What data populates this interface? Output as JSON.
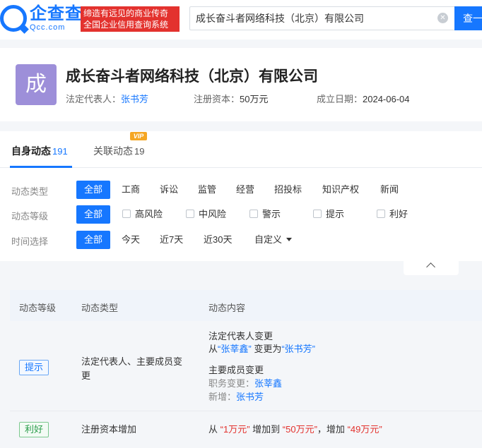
{
  "header": {
    "logo_cn": "企查查",
    "logo_en": "Qcc.com",
    "slogan_line1": "缔造有远见的商业传奇",
    "slogan_line2": "全国企业信用查询系统",
    "search_value": "成长奋斗者网络科技（北京）有限公司",
    "search_button": "查一"
  },
  "company": {
    "avatar_char": "成",
    "name": "成长奋斗者网络科技（北京）有限公司",
    "legal_rep_label": "法定代表人：",
    "legal_rep": "张书芳",
    "capital_label": "注册资本：",
    "capital": "50万元",
    "founded_label": "成立日期：",
    "founded": "2024-06-04"
  },
  "tabs": [
    {
      "label": "自身动态",
      "count": "191"
    },
    {
      "label": "关联动态",
      "count": "19",
      "badge": "VIP"
    }
  ],
  "filters": {
    "type_label": "动态类型",
    "type_options": [
      "全部",
      "工商",
      "诉讼",
      "监管",
      "经营",
      "招投标",
      "知识产权",
      "新闻"
    ],
    "level_label": "动态等级",
    "level_options": [
      "全部",
      "高风险",
      "中风险",
      "警示",
      "提示",
      "利好"
    ],
    "time_label": "时间选择",
    "time_options": [
      "全部",
      "今天",
      "近7天",
      "近30天",
      "自定义"
    ]
  },
  "table": {
    "headers": [
      "动态等级",
      "动态类型",
      "动态内容"
    ],
    "rows": [
      {
        "level": "提示",
        "type_line1": "法定代表人、主要成员变",
        "type_line2": "更",
        "c1_title": "法定代表人变更",
        "c1_from_prefix": "从",
        "c1_from": "“张莘鑫”",
        "c1_mid": "变更为",
        "c1_to": "“张书芳”",
        "c2_title": "主要成员变更",
        "c2_change_label": "职务变更：",
        "c2_change_value": "张莘鑫",
        "c2_new_label": "新增：",
        "c2_new_value": "张书芳"
      },
      {
        "level": "利好",
        "type_line1": "注册资本增加",
        "from_prefix": "从",
        "from_value": "“1万元”",
        "mid1": "增加到",
        "to_value": "“50万元”",
        "mid2": "，增加",
        "delta": "“49万元”"
      }
    ]
  },
  "colors": {
    "brand": "#1677ff",
    "slogan_bg": "#e3322e",
    "avatar_bg": "#9d8fd9",
    "tip": "#1677ff",
    "good": "#2a9d4b",
    "highlight": "#e3322e"
  }
}
